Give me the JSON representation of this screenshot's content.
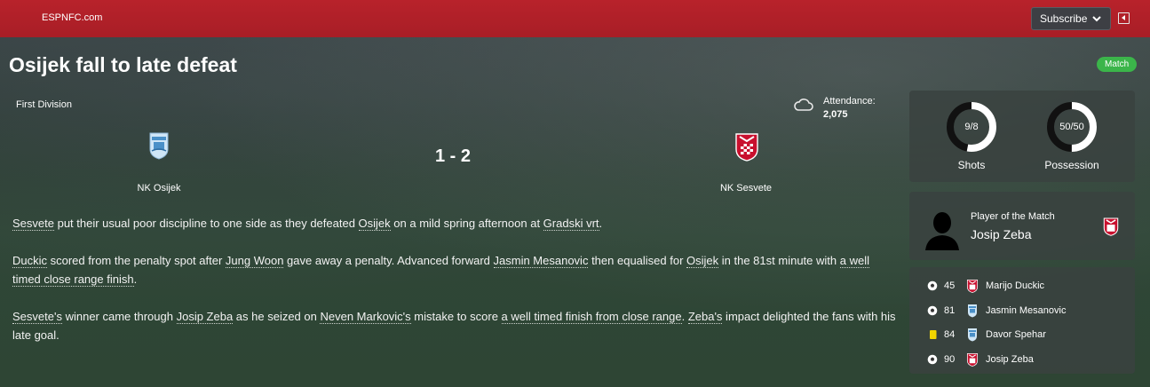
{
  "header": {
    "brand": "ESPNFC.com",
    "subscribe_label": "Subscribe"
  },
  "article": {
    "headline": "Osijek fall to late defeat",
    "tag": "Match"
  },
  "match": {
    "competition": "First Division",
    "attendance_label": "Attendance:",
    "attendance_value": "2,075",
    "score": "1 - 2",
    "home_team": "NK Osijek",
    "away_team": "NK Sesvete",
    "weather_icon": "cloud-icon"
  },
  "report": {
    "p1": [
      {
        "t": "Sesvete",
        "link": true
      },
      {
        "t": " put their usual poor discipline to one side as they defeated ",
        "link": false
      },
      {
        "t": "Osijek",
        "link": true
      },
      {
        "t": " on a mild spring afternoon at ",
        "link": false
      },
      {
        "t": "Gradski vrt",
        "link": true
      },
      {
        "t": ".",
        "link": false
      }
    ],
    "p2": [
      {
        "t": "Duckic",
        "link": true
      },
      {
        "t": " scored from the penalty spot after ",
        "link": false
      },
      {
        "t": "Jung Woon",
        "link": true
      },
      {
        "t": " gave away a penalty. Advanced forward ",
        "link": false
      },
      {
        "t": "Jasmin Mesanovic",
        "link": true
      },
      {
        "t": " then equalised for ",
        "link": false
      },
      {
        "t": "Osijek",
        "link": true
      },
      {
        "t": " in the 81st minute with ",
        "link": false
      },
      {
        "t": "a well timed close range finish",
        "link": true
      },
      {
        "t": ".",
        "link": false
      }
    ],
    "p3": [
      {
        "t": "Sesvete's",
        "link": true
      },
      {
        "t": " winner came through ",
        "link": false
      },
      {
        "t": "Josip Zeba",
        "link": true
      },
      {
        "t": " as he seized on ",
        "link": false
      },
      {
        "t": "Neven Markovic's",
        "link": true
      },
      {
        "t": " mistake to score ",
        "link": false
      },
      {
        "t": "a well timed finish from close range",
        "link": true
      },
      {
        "t": ". ",
        "link": false
      },
      {
        "t": "Zeba's",
        "link": true
      },
      {
        "t": " impact delighted the fans with his late goal.",
        "link": false
      }
    ]
  },
  "stats": {
    "shots": {
      "label": "Shots",
      "value": "9/8",
      "home": 9,
      "away": 8
    },
    "possession": {
      "label": "Possession",
      "value": "50/50",
      "home": 50,
      "away": 50
    }
  },
  "potm": {
    "label": "Player of the Match",
    "name": "Josip Zeba"
  },
  "events": [
    {
      "icon": "ball-icon",
      "minute": "45",
      "team": "away",
      "player": "Marijo Duckic"
    },
    {
      "icon": "ball-icon",
      "minute": "81",
      "team": "home",
      "player": "Jasmin Mesanovic"
    },
    {
      "icon": "yellow-card-icon",
      "minute": "84",
      "team": "home",
      "player": "Davor Spehar"
    },
    {
      "icon": "ball-icon",
      "minute": "90",
      "team": "away",
      "player": "Josip Zeba"
    }
  ],
  "colors": {
    "header_red": "#b8222b",
    "tag_green": "#3bb54a",
    "ring_white": "#ffffff",
    "ring_black": "#111111",
    "yellow_card": "#f2d600"
  }
}
